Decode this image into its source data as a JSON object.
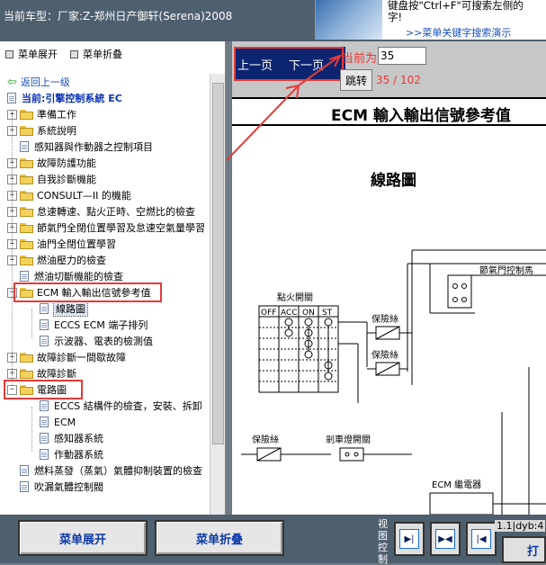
{
  "header": {
    "car_title": "当前车型：厂家:Z-郑州日产御轩(Serena)2008",
    "hint_line1": "键盘按\"Ctrl+F\"可搜索左侧的",
    "hint_line2": "字!",
    "hint_link": ">>菜单关键字搜索演示"
  },
  "sidebar": {
    "expand_all": "菜单展开",
    "collapse_all": "菜单折叠",
    "back_link": "返回上一级",
    "current": "当前:引擎控制系統 EC",
    "items": [
      {
        "label": "準備工作",
        "type": "folder",
        "toggle": "+"
      },
      {
        "label": "系統說明",
        "type": "folder",
        "toggle": "+"
      },
      {
        "label": "感知器與作動器之控制項目",
        "type": "doc"
      },
      {
        "label": "故障防護功能",
        "type": "folder",
        "toggle": "+"
      },
      {
        "label": "自我診斷機能",
        "type": "folder",
        "toggle": "+"
      },
      {
        "label": "CONSULT—II 的機能",
        "type": "folder",
        "toggle": "+"
      },
      {
        "label": "怠速轉速、點火正時、空燃比的檢查",
        "type": "folder",
        "toggle": "+"
      },
      {
        "label": "節氣門全閉位置學習及怠速空氣量學習",
        "type": "folder",
        "toggle": "+"
      },
      {
        "label": "油門全閉位置學習",
        "type": "folder",
        "toggle": "+"
      },
      {
        "label": "燃油壓力的檢查",
        "type": "folder",
        "toggle": "+"
      },
      {
        "label": "燃油切斷機能的檢查",
        "type": "doc"
      },
      {
        "label": "ECM 輸入輸出信號參考值",
        "type": "folder-open",
        "toggle": "−"
      },
      {
        "label": "線路圖",
        "type": "doc",
        "level": 2
      },
      {
        "label": "ECCS ECM 端子排列",
        "type": "doc",
        "level": 2
      },
      {
        "label": "示波器、電表的檢測值",
        "type": "doc",
        "level": 2
      },
      {
        "label": "故障診斷一間歇故障",
        "type": "folder",
        "toggle": "+"
      },
      {
        "label": "故障診斷",
        "type": "folder",
        "toggle": "+"
      },
      {
        "label": "電路圖",
        "type": "folder-open",
        "toggle": "−"
      },
      {
        "label": "ECCS 結構件的檢查，安裝、拆卸",
        "type": "doc",
        "level": 2
      },
      {
        "label": "ECM",
        "type": "doc",
        "level": 2
      },
      {
        "label": "感知器系統",
        "type": "doc",
        "level": 2
      },
      {
        "label": "作動器系統",
        "type": "doc",
        "level": 2
      },
      {
        "label": "燃料蒸發（蒸氣）氣體抑制裝置的檢查",
        "type": "doc"
      },
      {
        "label": "吹漏氣體控制閥",
        "type": "doc"
      }
    ]
  },
  "navigation": {
    "prev_page": "上一页",
    "next_page": "下一页",
    "current_label": "当前为",
    "page_value": "35",
    "jump_label": "跳转",
    "page_count": "35 / 102"
  },
  "document": {
    "title": "ECM 輸入輸出信號參考值",
    "subtitle": "線路圖",
    "diagram": {
      "ignition_switch": "點火開關",
      "switch_positions": [
        "OFF",
        "ACC",
        "ON",
        "ST"
      ],
      "fuse_a": "保險絲",
      "fuse_b": "保險絲",
      "fuse_c": "保險絲",
      "brake_switch": "剎車燈開關",
      "throttle_relay": "節氣門控制馬",
      "ecm_relay": "ECM 繼電器"
    }
  },
  "bottom": {
    "expand_button": "菜单展开",
    "collapse_button": "菜单折叠",
    "view_control_label": "视图控制",
    "url_fragment": "1.1|dyb:4",
    "print_button": "打"
  },
  "colors": {
    "annotation_red": "#e53a3a",
    "link_blue": "#1a4fb8",
    "page_nav_bg": "#0d2570",
    "chrome_gray": "#4e5f6e"
  }
}
